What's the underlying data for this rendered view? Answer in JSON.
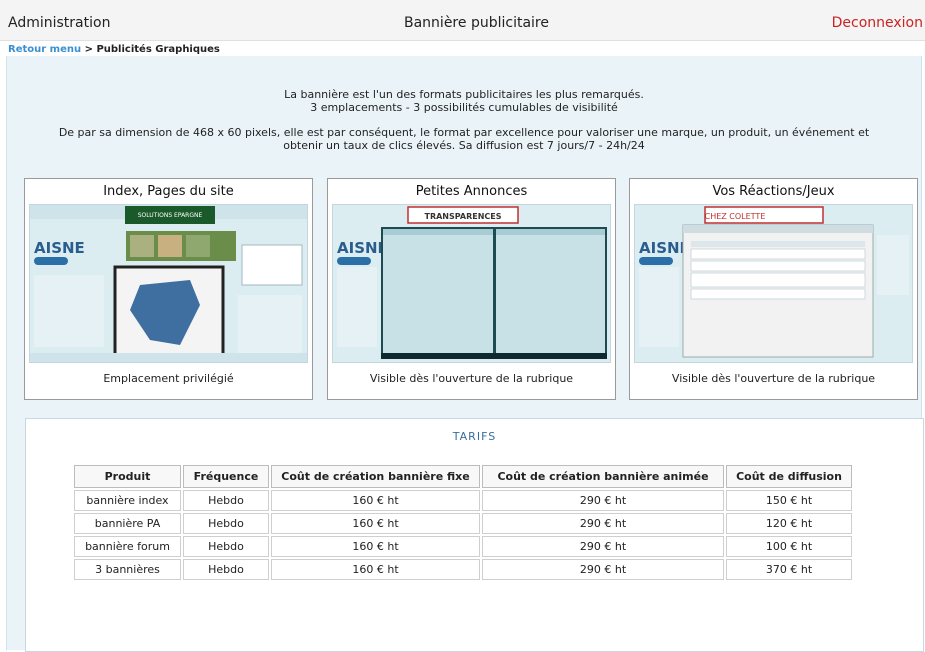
{
  "header": {
    "left": "Administration",
    "center": "Bannière publicitaire",
    "logout": "Deconnexion"
  },
  "breadcrumb": {
    "link": "Retour menu",
    "separator": " > ",
    "current": "Publicités Graphiques"
  },
  "intro": {
    "line1": "La bannière est l'un des formats publicitaires les plus remarqués.",
    "line2": "3 emplacements - 3 possibilités cumulables de visibilité",
    "line3": "De par sa dimension de 468 x 60 pixels, elle est par conséquent, le format par excellence pour valoriser une marque, un produit, un événement et",
    "line4": "obtenir un taux de clics élevés. Sa diffusion est 7 jours/7 - 24h/24"
  },
  "placements": [
    {
      "title": "Index, Pages du site",
      "caption": "Emplacement privilégié",
      "banner_text": "SOLUTIONS EPARGNE",
      "logo": "AISNE"
    },
    {
      "title": "Petites Annonces",
      "caption": "Visible dès l'ouverture de la rubrique",
      "banner_text": "TRANSPARENCES",
      "logo": "AISNE"
    },
    {
      "title": "Vos Réactions/Jeux",
      "caption": "Visible dès l'ouverture de la rubrique",
      "banner_text": "CHEZ COLETTE",
      "logo": "AISNE"
    }
  ],
  "tarifs": {
    "title": "TARIFS",
    "columns": [
      "Produit",
      "Fréquence",
      "Coût de création bannière fixe",
      "Coût de création bannière animée",
      "Coût de diffusion"
    ],
    "rows": [
      [
        "bannière index",
        "Hebdo",
        "160 € ht",
        "290 € ht",
        "150 € ht"
      ],
      [
        "bannière PA",
        "Hebdo",
        "160 € ht",
        "290 € ht",
        "120 € ht"
      ],
      [
        "bannière forum",
        "Hebdo",
        "160 € ht",
        "290 € ht",
        "100 € ht"
      ],
      [
        "3 bannières",
        "Hebdo",
        "160 € ht",
        "290 € ht",
        "370 € ht"
      ]
    ]
  },
  "colors": {
    "logout": "#cc2222",
    "link": "#3a8fd0",
    "background": "#eaf4f8"
  }
}
